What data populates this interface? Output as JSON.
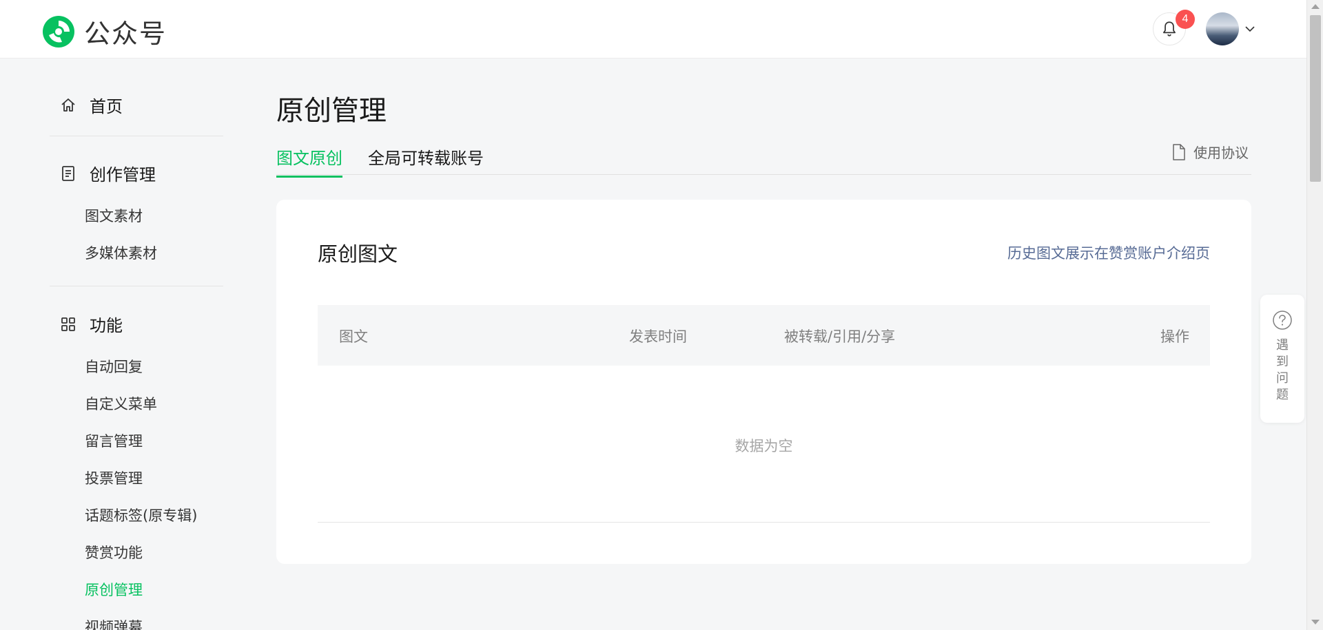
{
  "header": {
    "logo_text": "公众号",
    "notification_count": "4",
    "brand_color": "#07c160"
  },
  "sidebar": {
    "home": "首页",
    "creation": "创作管理",
    "creation_items": [
      "图文素材",
      "多媒体素材"
    ],
    "features": "功能",
    "feature_items": [
      "自动回复",
      "自定义菜单",
      "留言管理",
      "投票管理",
      "话题标签(原专辑)",
      "赞赏功能",
      "原创管理",
      "视频弹幕"
    ],
    "active_item": "原创管理"
  },
  "main": {
    "title": "原创管理",
    "tabs": [
      {
        "label": "图文原创",
        "active": true
      },
      {
        "label": "全局可转载账号",
        "active": false
      }
    ],
    "agreement": "使用协议",
    "card": {
      "title": "原创图文",
      "link": "历史图文展示在赞赏账户介绍页",
      "columns": [
        "图文",
        "发表时间",
        "被转载/引用/分享",
        "操作"
      ],
      "empty_text": "数据为空"
    }
  },
  "help": {
    "label": "遇到问题"
  }
}
